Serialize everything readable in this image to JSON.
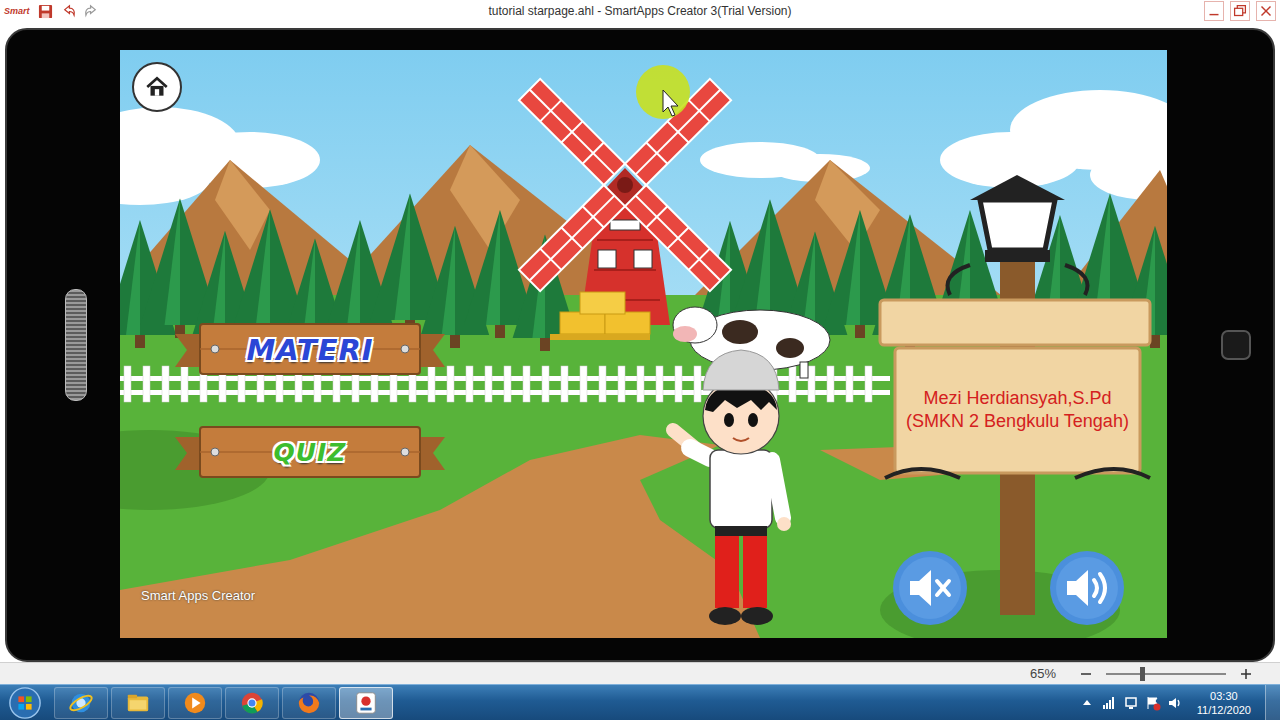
{
  "window": {
    "title": "tutorial starpage.ahl - SmartApps Creator 3(Trial Version)",
    "logo": "Smart"
  },
  "app": {
    "menu_buttons": [
      {
        "label": "MATERI",
        "color": "#2b46d6"
      },
      {
        "label": "QUIZ",
        "color": "#3dbd2e"
      }
    ],
    "sign": {
      "lines": [
        "Mezi Herdiansyah,S.Pd",
        "(SMKN 2 Bengkulu Tengah)"
      ]
    },
    "watermark": "Smart Apps Creator",
    "sound_buttons": [
      {
        "kind": "mute"
      },
      {
        "kind": "sound"
      }
    ]
  },
  "status_bar": {
    "zoom": "65%",
    "zoom_level": 0.3
  },
  "taskbar": {
    "apps": [
      {
        "kind": "ie",
        "selected": false
      },
      {
        "kind": "explorer",
        "selected": false
      },
      {
        "kind": "media",
        "selected": false
      },
      {
        "kind": "chrome",
        "selected": false
      },
      {
        "kind": "firefox",
        "selected": false
      },
      {
        "kind": "sac",
        "selected": true
      }
    ],
    "time": "03:30",
    "date": "11/12/2020"
  }
}
